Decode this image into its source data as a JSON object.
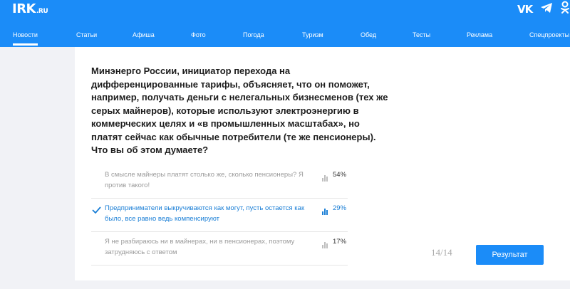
{
  "header": {
    "logo": "IRK",
    "logo_suffix": ".RU",
    "social": {
      "vk_label": "VK"
    },
    "nav": [
      {
        "label": "Новости"
      },
      {
        "label": "Статьи"
      },
      {
        "label": "Афиша"
      },
      {
        "label": "Фото"
      },
      {
        "label": "Погода"
      },
      {
        "label": "Туризм"
      },
      {
        "label": "Обед"
      },
      {
        "label": "Тесты"
      },
      {
        "label": "Реклама"
      },
      {
        "label": "Спецпроекты"
      }
    ]
  },
  "quiz": {
    "question": "Минэнерго России, инициатор перехода на дифференцированные тарифы, объясняет, что он поможет, например, получать деньги с нелегальных бизнесменов (тех же серых майнеров), которые используют электроэнергию в коммерческих целях и «в промышленных масштабах», но платят сейчас как обычные потребители (те же пенсионеры). Что вы об этом думаете?",
    "options": [
      {
        "text": "В смысле майнеры платят столько же, сколько пенсионеры? Я против такого!",
        "percent": "54%",
        "selected": false
      },
      {
        "text": "Предприниматели выкручиваются как могут, пусть остается как было, все равно ведь компенсируют",
        "percent": "29%",
        "selected": true
      },
      {
        "text": "Я не разбираюсь ни в майнерах, ни в пенсионерах, поэтому затрудняюсь с ответом",
        "percent": "17%",
        "selected": false
      }
    ],
    "counter": "14/14",
    "result_button": "Результат"
  },
  "colors": {
    "brand": "#1b8cf8",
    "selected": "#1b7fd6",
    "muted_text": "#9a9a9a"
  },
  "icons": [
    "vk-icon",
    "telegram-icon",
    "odnoklassniki-icon",
    "check-icon",
    "bar-chart-icon"
  ]
}
